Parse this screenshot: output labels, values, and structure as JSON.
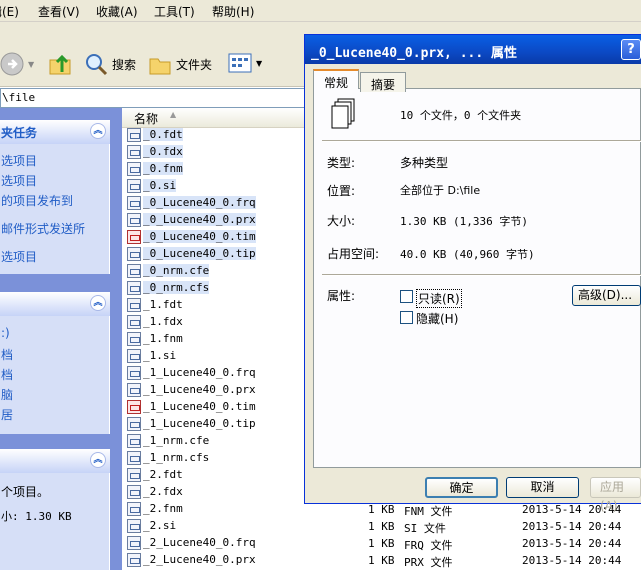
{
  "menubar": {
    "items": [
      "编辑(E)",
      "查看(V)",
      "收藏(A)",
      "工具(T)",
      "帮助(H)"
    ]
  },
  "toolbar": {
    "search_label": "搜索",
    "folders_label": "文件夹"
  },
  "address": {
    "value": "\\file"
  },
  "taskpane": {
    "panel1": {
      "title": "夹任务",
      "links": [
        "选项目",
        "选项目",
        "的项目发布到",
        "邮件形式发送所",
        "选项目"
      ]
    },
    "panel2": {
      "items": [
        ":)",
        "档",
        "档",
        "脑",
        "居"
      ]
    },
    "panel3": {
      "line1": "个项目。",
      "line2": "小: 1.30 KB"
    }
  },
  "filelist": {
    "column_header": "名称",
    "files": [
      {
        "name": "_0.fdt",
        "icon": "file-icon",
        "selected": true
      },
      {
        "name": "_0.fdx",
        "icon": "file-icon",
        "selected": true
      },
      {
        "name": "_0.fnm",
        "icon": "file-icon",
        "selected": true
      },
      {
        "name": "_0.si",
        "icon": "file-icon",
        "selected": true
      },
      {
        "name": "_0_Lucene40_0.frq",
        "icon": "file-icon",
        "selected": true
      },
      {
        "name": "_0_Lucene40_0.prx",
        "icon": "file-icon",
        "selected": true
      },
      {
        "name": "_0_Lucene40_0.tim",
        "icon": "tim-file-icon",
        "selected": true
      },
      {
        "name": "_0_Lucene40_0.tip",
        "icon": "file-icon",
        "selected": true
      },
      {
        "name": "_0_nrm.cfe",
        "icon": "file-icon",
        "selected": true
      },
      {
        "name": "_0_nrm.cfs",
        "icon": "file-icon",
        "selected": true
      },
      {
        "name": "_1.fdt",
        "icon": "file-icon",
        "selected": false
      },
      {
        "name": "_1.fdx",
        "icon": "file-icon",
        "selected": false
      },
      {
        "name": "_1.fnm",
        "icon": "file-icon",
        "selected": false
      },
      {
        "name": "_1.si",
        "icon": "file-icon",
        "selected": false
      },
      {
        "name": "_1_Lucene40_0.frq",
        "icon": "file-icon",
        "selected": false
      },
      {
        "name": "_1_Lucene40_0.prx",
        "icon": "file-icon",
        "selected": false
      },
      {
        "name": "_1_Lucene40_0.tim",
        "icon": "tim-file-icon",
        "selected": false
      },
      {
        "name": "_1_Lucene40_0.tip",
        "icon": "file-icon",
        "selected": false
      },
      {
        "name": "_1_nrm.cfe",
        "icon": "file-icon",
        "selected": false
      },
      {
        "name": "_1_nrm.cfs",
        "icon": "file-icon",
        "selected": false
      },
      {
        "name": "_2.fdt",
        "icon": "file-icon",
        "selected": false
      },
      {
        "name": "_2.fdx",
        "icon": "file-icon",
        "selected": false
      },
      {
        "name": "_2.fnm",
        "icon": "file-icon",
        "selected": false
      },
      {
        "name": "_2.si",
        "icon": "file-icon",
        "selected": false
      },
      {
        "name": "_2_Lucene40_0.frq",
        "icon": "file-icon",
        "selected": false
      },
      {
        "name": "_2_Lucene40_0.prx",
        "icon": "file-icon",
        "selected": false
      }
    ],
    "details": [
      {
        "size": "1 KB",
        "type": "FNM 文件",
        "date": "2013-5-14 20:44"
      },
      {
        "size": "1 KB",
        "type": "SI 文件",
        "date": "2013-5-14 20:44"
      },
      {
        "size": "1 KB",
        "type": "FRQ 文件",
        "date": "2013-5-14 20:44"
      },
      {
        "size": "1 KB",
        "type": "PRX 文件",
        "date": "2013-5-14 20:44"
      }
    ]
  },
  "dialog": {
    "title": "_0_Lucene40_0.prx, ... 属性",
    "help": "?",
    "tabs": [
      "常规",
      "摘要"
    ],
    "summary": "10 个文件，0 个文件夹",
    "type_label": "类型:",
    "type_value": "多种类型",
    "location_label": "位置:",
    "location_value": "全部位于 D:\\file",
    "size_label": "大小:",
    "size_value": "1.30 KB (1,336 字节)",
    "disk_label": "占用空间:",
    "disk_value": "40.0 KB (40,960 字节)",
    "attr_label": "属性:",
    "readonly_label": "只读(R)",
    "hidden_label": "隐藏(H)",
    "advanced_label": "高级(D)...",
    "ok_label": "确定",
    "cancel_label": "取消",
    "apply_label": "应用(A)"
  }
}
